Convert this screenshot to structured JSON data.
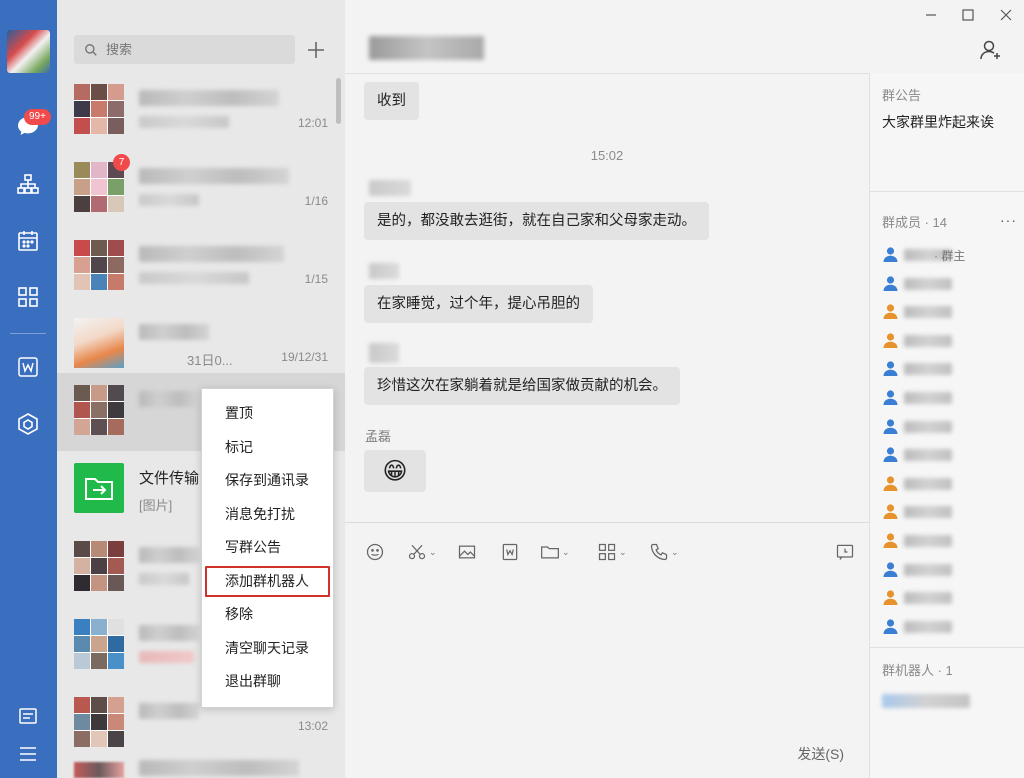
{
  "nav": {
    "unread_badge": "99+",
    "icons": [
      "chat-icon",
      "org-chart-icon",
      "calendar-icon",
      "apps-grid-icon",
      "doc-w-icon",
      "hexagon-icon",
      "notes-icon",
      "menu-icon"
    ],
    "accent": "#3a6fbf"
  },
  "search": {
    "placeholder": "搜索"
  },
  "conversations": [
    {
      "time": "12:01",
      "badge": ""
    },
    {
      "time": "1/16",
      "badge": "7"
    },
    {
      "time": "1/15",
      "badge": ""
    },
    {
      "time": "19/12/31",
      "preview": "31日0...",
      "badge": ""
    },
    {
      "time": "",
      "badge": "",
      "selected": true
    },
    {
      "name": "文件传输",
      "preview": "[图片]",
      "badge": ""
    },
    {
      "time": "",
      "badge": ""
    },
    {
      "time": "",
      "badge": ""
    },
    {
      "time": "13:02",
      "badge": ""
    }
  ],
  "context_menu": {
    "items": [
      "置顶",
      "标记",
      "保存到通讯录",
      "消息免打扰",
      "写群公告",
      "添加群机器人",
      "移除",
      "清空聊天记录",
      "退出群聊"
    ],
    "highlighted": "添加群机器人"
  },
  "chat": {
    "messages": [
      {
        "text": "收到"
      },
      {
        "timestamp": "15:02"
      },
      {
        "text": "是的，都没敢去逛街，就在自己家和父母家走动。"
      },
      {
        "text": "在家睡觉，过个年，提心吊胆的"
      },
      {
        "text": "珍惜这次在家躺着就是给国家做贡献的机会。"
      },
      {
        "sender": "孟磊",
        "emoji": "😁"
      }
    ],
    "send_label": "发送(S)"
  },
  "right_panel": {
    "notice_title": "群公告",
    "notice_text": "大家群里炸起来诶",
    "members_title": "群成员 · 14",
    "owner_label": "· 群主",
    "more": "···",
    "robots_title": "群机器人 · 1",
    "member_colors": [
      "#3b7fd4",
      "#3b7fd4",
      "#e8922e",
      "#e8922e",
      "#3b7fd4",
      "#3b7fd4",
      "#3b7fd4",
      "#3b7fd4",
      "#e8922e",
      "#e8922e",
      "#e8922e",
      "#3b7fd4",
      "#e8922e",
      "#3b7fd4"
    ]
  }
}
